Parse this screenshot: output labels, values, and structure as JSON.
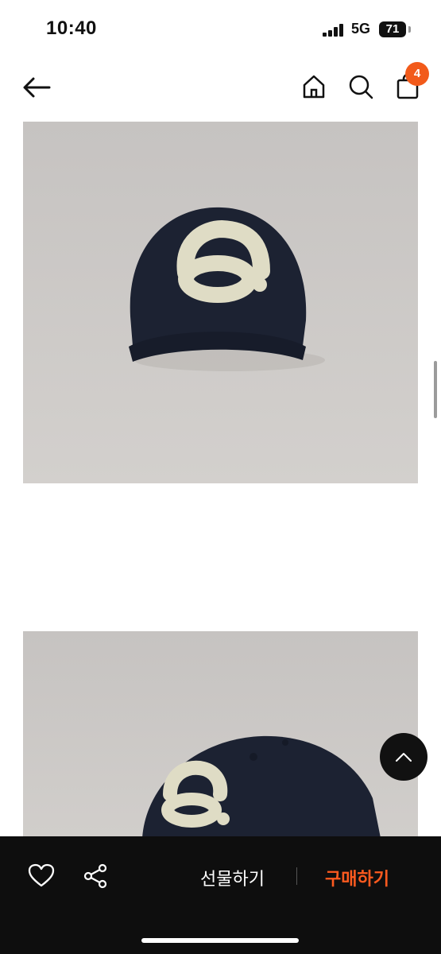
{
  "status_bar": {
    "time": "10:40",
    "network": "5G",
    "battery": "71"
  },
  "nav": {
    "back_icon": "back-arrow-icon",
    "home_icon": "home-icon",
    "search_icon": "search-icon",
    "bag_icon": "shopping-bag-icon",
    "cart_count": "4"
  },
  "images": [
    {
      "name": "navy cap with cream patch logo - front"
    },
    {
      "name": "navy cap with cream patch logo - angled"
    }
  ],
  "bottom_bar": {
    "wishlist_icon": "heart-icon",
    "share_icon": "share-icon",
    "gift_label": "선물하기",
    "buy_label": "구매하기",
    "buy_color": "#ff5a1f"
  },
  "colors": {
    "badge": "#f25a1a",
    "bar_bg": "#0e0e0e",
    "image_bg": "#c9c6c3"
  }
}
